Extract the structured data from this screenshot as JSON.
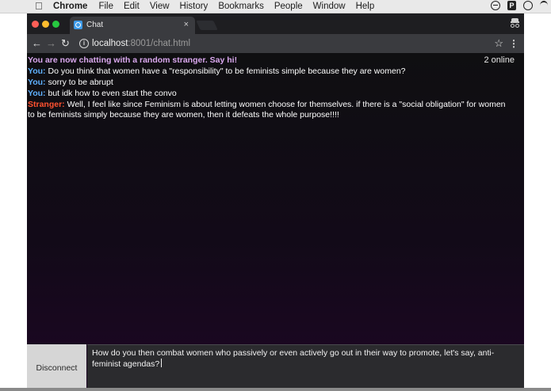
{
  "menubar": {
    "app_name": "Chrome",
    "items": [
      "File",
      "Edit",
      "View",
      "History",
      "Bookmarks",
      "People",
      "Window",
      "Help"
    ],
    "tray_icons": [
      "do-not-disturb-icon",
      "p-icon",
      "clock-icon",
      "wifi-icon"
    ]
  },
  "browser": {
    "tab_title": "Chat",
    "tab_close": "×",
    "url_host": "localhost",
    "url_rest": ":8001/chat.html",
    "accent": "#3d9ae8"
  },
  "chat": {
    "online_count": "2 online",
    "system_message": "You are now chatting with a random stranger. Say hi!",
    "messages": [
      {
        "speaker": "You:",
        "text": " Do you think that women have a \"responsibility\" to be feminists simple because they are women?"
      },
      {
        "speaker": "You:",
        "text": " sorry to be abrupt"
      },
      {
        "speaker": "You:",
        "text": " but idk how to even start the convo"
      },
      {
        "speaker": "Stranger:",
        "text": " Well, I feel like since Feminism is about letting women choose for themselves. if there is a \"social obligation\" for women to be feminists simply because they are women, then it defeats the whole purpose!!!!"
      }
    ],
    "colors": {
      "you": "#5fb0ff",
      "stranger": "#ff5230",
      "system": "#d9a7ee"
    },
    "disconnect_label": "Disconnect",
    "draft": "How do you then combat women who passively or even actively go out in their way to promote, let's say, anti-feminist agendas?"
  }
}
